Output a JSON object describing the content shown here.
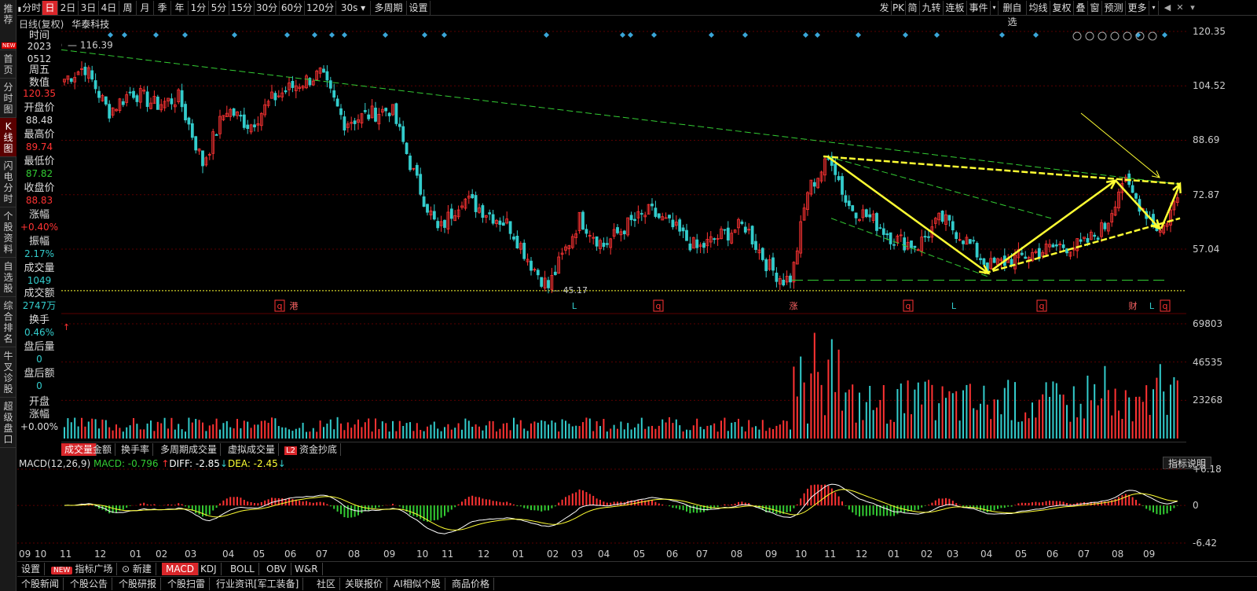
{
  "left_nav": [
    {
      "label": "推荐",
      "badge": "NEW",
      "active": false
    },
    {
      "label": "首页",
      "active": false
    },
    {
      "label": "分时图",
      "active": false
    },
    {
      "label": "K线图",
      "active": true
    },
    {
      "label": "闪电分时",
      "active": false
    },
    {
      "label": "个股资料",
      "active": false
    },
    {
      "label": "自选股",
      "active": false
    },
    {
      "label": "综合排名",
      "active": false
    },
    {
      "label": "牛叉诊股",
      "active": false
    },
    {
      "label": "超级盘口",
      "active": false
    }
  ],
  "toolbar": {
    "periods": [
      "分时",
      "日",
      "2日",
      "3日",
      "4日",
      "周",
      "月",
      "季",
      "年",
      "1分",
      "5分",
      "15分",
      "30分",
      "60分",
      "120分",
      "30s"
    ],
    "active_period": "日",
    "multi_period": "多周期",
    "settings": "设置",
    "right_buttons": [
      "发",
      "PK",
      "简",
      "九转",
      "连板",
      "事件",
      "删自选",
      "均线",
      "复权",
      "叠",
      "窗",
      "预测",
      "更多"
    ]
  },
  "chart": {
    "title": "日线(复权)",
    "stock_name": "华泰科技",
    "high_label": "116.39",
    "low_label": "45.17",
    "bottom_markers": [
      "q",
      "港",
      "L",
      "q",
      "涨",
      "q",
      "L",
      "q",
      "财",
      "L",
      "q"
    ]
  },
  "info_panel": {
    "items": [
      {
        "label": "时间",
        "value": "2023",
        "color": "#ddd"
      },
      {
        "label": "",
        "value": "0512",
        "color": "#ddd"
      },
      {
        "label": "周五",
        "value": "",
        "color": "#ddd"
      },
      {
        "label": "数值",
        "value": "120.35",
        "color": "#ff3333"
      },
      {
        "label": "开盘价",
        "value": "88.48",
        "color": "#ddd"
      },
      {
        "label": "最高价",
        "value": "89.74",
        "color": "#ff3333"
      },
      {
        "label": "最低价",
        "value": "87.82",
        "color": "#33cc33"
      },
      {
        "label": "收盘价",
        "value": "88.83",
        "color": "#ff3333"
      },
      {
        "label": "涨幅",
        "value": "+0.40%",
        "color": "#ff3333"
      },
      {
        "label": "振幅",
        "value": "2.17%",
        "color": "#33cccc"
      },
      {
        "label": "成交量",
        "value": "1049",
        "color": "#33cccc"
      },
      {
        "label": "成交额",
        "value": "2747万",
        "color": "#33cccc"
      },
      {
        "label": "换手",
        "value": "0.46%",
        "color": "#33cccc"
      },
      {
        "label": "盘后量",
        "value": "0",
        "color": "#33cccc"
      },
      {
        "label": "盘后额",
        "value": "0",
        "color": "#33cccc"
      },
      {
        "label": "开盘涨幅",
        "value": "+0.00%",
        "color": "#ddd"
      }
    ]
  },
  "y_axis_main": [
    "120.35",
    "104.52",
    "88.69",
    "72.87",
    "57.04"
  ],
  "y_axis_volume": [
    "69803",
    "46535",
    "23268"
  ],
  "y_axis_macd": [
    "6.18",
    "0",
    "-6.42"
  ],
  "volume_tabs": [
    "成交量",
    "金额",
    "换手率",
    "多周期成交量",
    "虚拟成交量",
    "资金抄底"
  ],
  "volume_tab_l2": "L2",
  "macd": {
    "name": "MACD(12,26,9)",
    "macd_label": "MACD: -0.796",
    "diff_label": "DIFF: -2.85",
    "dea_label": "DEA: -2.45",
    "help": "指标说明"
  },
  "months": [
    "09",
    "10",
    "11",
    "12",
    "01",
    "02",
    "03",
    "04",
    "05",
    "06",
    "07",
    "08",
    "09",
    "10",
    "11",
    "12",
    "01",
    "02",
    "03",
    "04",
    "05",
    "06",
    "07",
    "08",
    "09",
    "10",
    "11",
    "12",
    "01",
    "02",
    "03",
    "04",
    "05",
    "06",
    "07",
    "08",
    "09"
  ],
  "bottom_bar1": {
    "settings": "设置",
    "new_tag": "NEW",
    "indicator_square": "指标广场",
    "new_build": "新建",
    "indicators": [
      "MACD",
      "KDJ",
      "BOLL",
      "OBV",
      "W&R"
    ],
    "active": "MACD"
  },
  "bottom_bar2": [
    "个股新闻",
    "个股公告",
    "个股研报",
    "个股扫雷",
    "行业资讯[军工装备]",
    "社区",
    "关联报价",
    "AI相似个股",
    "商品价格"
  ],
  "colors": {
    "up": "#ff3333",
    "down": "#33cccc",
    "accent": "#d9262a",
    "trend": "#ffff33",
    "green_line": "#33cc33"
  }
}
